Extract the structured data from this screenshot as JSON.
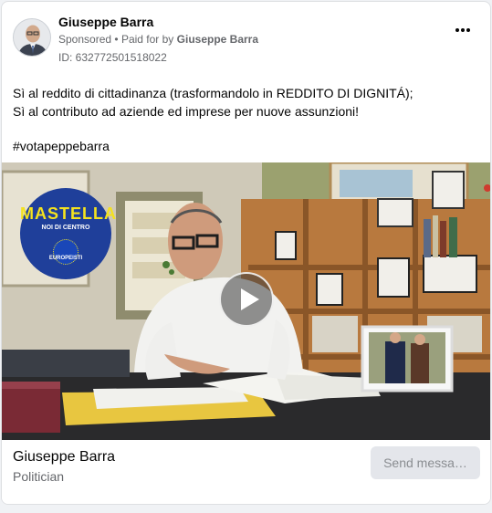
{
  "post": {
    "author_name": "Giuseppe Barra",
    "sponsored_label": "Sponsored",
    "separator": "•",
    "paid_for_prefix": "Paid for by",
    "paid_for_name": "Giuseppe Barra",
    "ad_id": "ID: 632772501518022",
    "more_icon": "more-horizontal-icon",
    "body_lines": [
      "Sì al reddito di cittadinanza (trasformandolo in REDDITO DI DIGNITÁ);",
      "Sì al contributo ad aziende ed imprese per nuove assunzioni!"
    ],
    "hashtag": "#votapeppebarra"
  },
  "video": {
    "play_icon": "play-icon",
    "logo": {
      "word": "MASTELLA",
      "sub": "NOI DI CENTRO",
      "eu": "EUROPEISTI"
    }
  },
  "footer": {
    "page_name": "Giuseppe Barra",
    "category": "Politician",
    "cta_label": "Send messa…"
  },
  "colors": {
    "background": "#f0f2f5",
    "card": "#ffffff",
    "secondary_text": "#65676b",
    "button_bg": "#e4e6eb",
    "logo_blue": "#1f3f9a",
    "logo_yellow": "#f4e21e"
  }
}
